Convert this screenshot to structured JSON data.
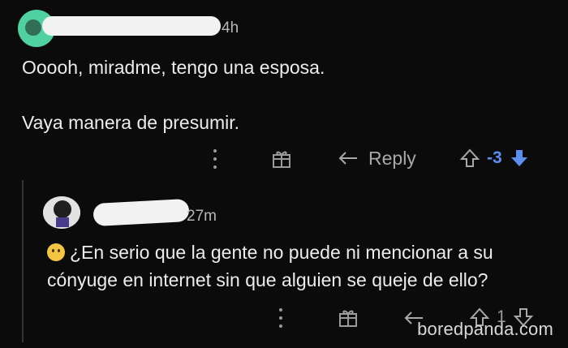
{
  "comment": {
    "time": "4h",
    "line1": "Ooooh, miradme, tengo una esposa.",
    "line2": "Vaya manera de presumir.",
    "reply_label": "Reply",
    "score": "-3"
  },
  "reply": {
    "time": "27m",
    "line1": "¿En serio que la gente no puede ni mencionar a su",
    "line2": "cónyuge en internet sin que alguien se queje de ello?",
    "score": "1"
  },
  "watermark": "boredpanda.com",
  "colors": {
    "background": "#0b0b0b",
    "text": "#ececec",
    "muted": "#a8a8a8",
    "downvote_blue": "#5b8ff0",
    "avatar_green": "#4fd1a1"
  }
}
